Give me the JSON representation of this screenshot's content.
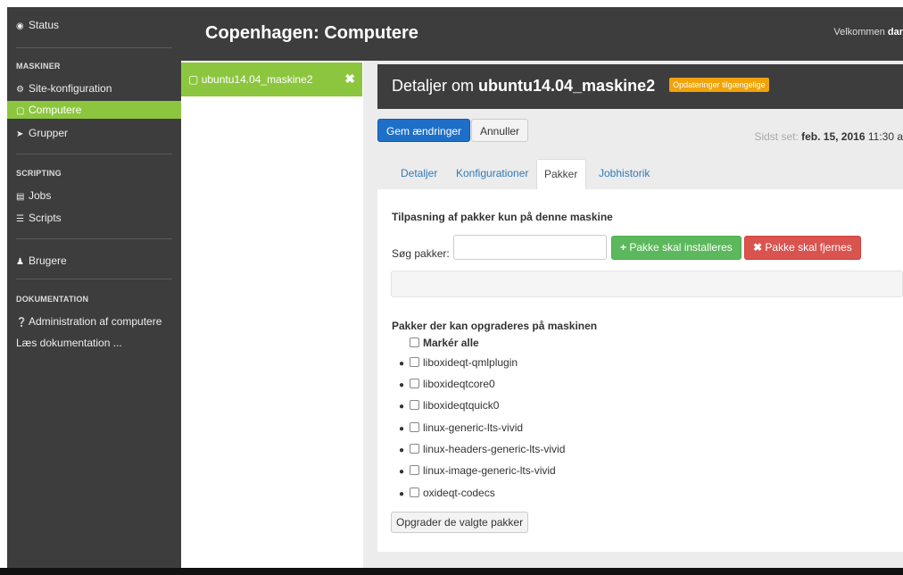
{
  "sidebar": {
    "status": "Status",
    "maskiner_head": "MASKINER",
    "site_konfiguration": "Site-konfiguration",
    "computere": "Computere",
    "grupper": "Grupper",
    "scripting_head": "SCRIPTING",
    "jobs": "Jobs",
    "scripts": "Scripts",
    "brugere": "Brugere",
    "dokumentation_head": "DOKUMENTATION",
    "administration": "Administration af computere",
    "laes": "Læs dokumentation ..."
  },
  "header": {
    "title": "Copenhagen: Computere",
    "welcome_prefix": "Velkommen ",
    "welcome_user": "dar"
  },
  "machine_list": {
    "items": [
      {
        "label": "ubuntu14.04_maskine2"
      }
    ]
  },
  "detail": {
    "title_prefix": "Detaljer om ",
    "machine_name": "ubuntu14.04_maskine2",
    "badge": "Opdateringer tilgængelige",
    "save_label": "Gem ændringer",
    "cancel_label": "Annuller",
    "last_seen_label": "Sidst set: ",
    "last_seen_date": "feb. 15, 2016",
    "last_seen_time": " 11:30 a",
    "tabs": [
      {
        "label": "Detaljer"
      },
      {
        "label": "Konfigurationer"
      },
      {
        "label": "Pakker"
      },
      {
        "label": "Jobhistorik"
      }
    ]
  },
  "packages": {
    "section_title": "Tilpasning af pakker kun på denne maskine",
    "search_label": "Søg pakker:",
    "search_value": "",
    "install_label": "Pakke skal installeres",
    "remove_label": "Pakke skal fjernes",
    "upgradable_title": "Pakker der kan opgraderes på maskinen",
    "select_all": "Markér alle",
    "items": [
      "liboxideqt-qmlplugin",
      "liboxideqtcore0",
      "liboxideqtquick0",
      "linux-generic-lts-vivid",
      "linux-headers-generic-lts-vivid",
      "linux-image-generic-lts-vivid",
      "oxideqt-codecs"
    ],
    "upgrade_button": "Opgrader de valgte pakker"
  },
  "colors": {
    "accent_green": "#8cc63f",
    "dark": "#3d3d3d",
    "primary": "#1e6fc8",
    "badge": "#f0a30a",
    "danger": "#d9534f",
    "success": "#5cb85c"
  }
}
